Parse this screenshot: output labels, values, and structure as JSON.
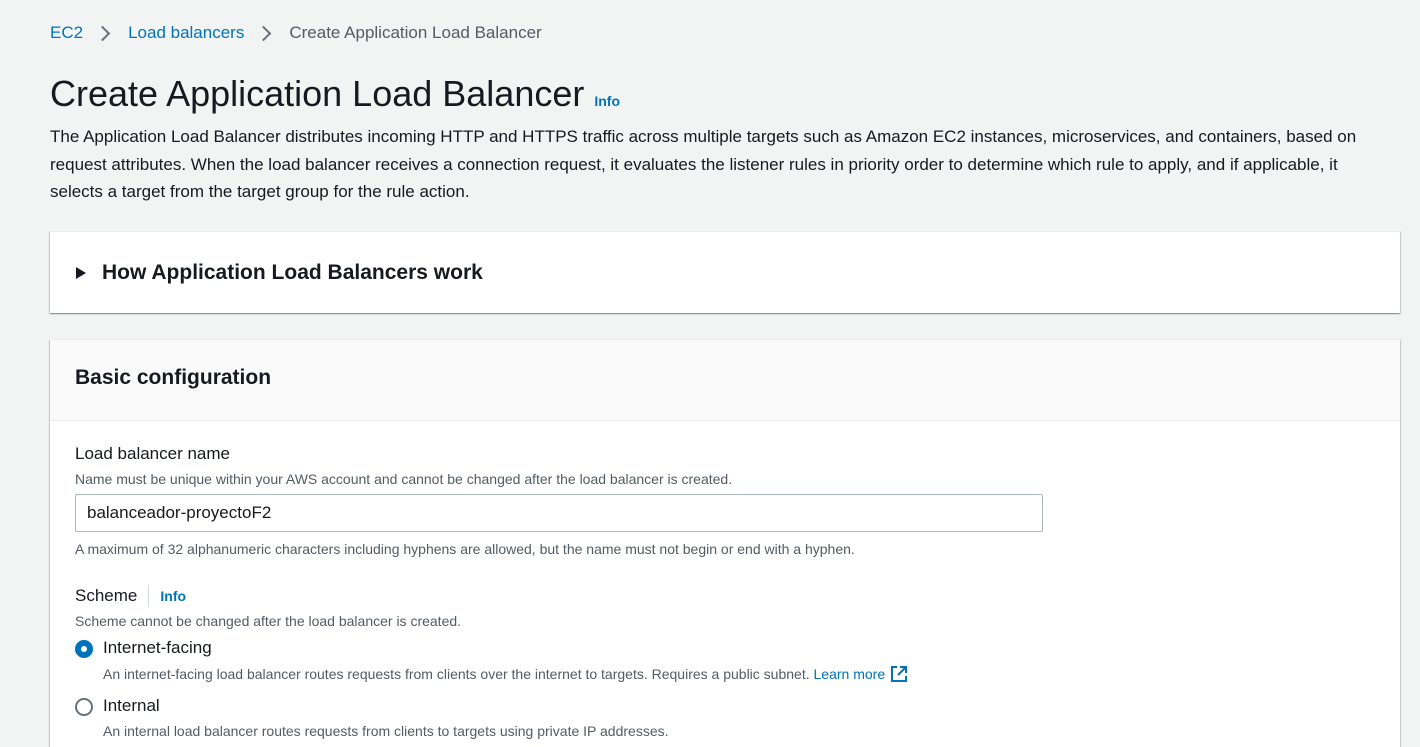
{
  "breadcrumb": {
    "items": [
      "EC2",
      "Load balancers"
    ],
    "current": "Create Application Load Balancer"
  },
  "header": {
    "title": "Create Application Load Balancer",
    "info": "Info",
    "description": "The Application Load Balancer distributes incoming HTTP and HTTPS traffic across multiple targets such as Amazon EC2 instances, microservices, and containers, based on request attributes. When the load balancer receives a connection request, it evaluates the listener rules in priority order to determine which rule to apply, and if applicable, it selects a target from the target group for the rule action."
  },
  "how_it_works": {
    "title": "How Application Load Balancers work"
  },
  "basic_config": {
    "title": "Basic configuration",
    "name_field": {
      "label": "Load balancer name",
      "description": "Name must be unique within your AWS account and cannot be changed after the load balancer is created.",
      "value": "balanceador-proyectoF2",
      "constraint": "A maximum of 32 alphanumeric characters including hyphens are allowed, but the name must not begin or end with a hyphen."
    },
    "scheme": {
      "label": "Scheme",
      "info": "Info",
      "description": "Scheme cannot be changed after the load balancer is created.",
      "options": [
        {
          "label": "Internet-facing",
          "description": "An internet-facing load balancer routes requests from clients over the internet to targets. Requires a public subnet.",
          "link": "Learn more",
          "selected": true
        },
        {
          "label": "Internal",
          "description": "An internal load balancer routes requests from clients to targets using private IP addresses.",
          "selected": false
        }
      ]
    }
  },
  "colors": {
    "link": "#0073bb",
    "background": "#f2f3f3",
    "text": "#16191f",
    "secondary_text": "#545b64"
  },
  "icons": {
    "external_link": "external-link-icon",
    "caret": "caret-right-icon"
  }
}
